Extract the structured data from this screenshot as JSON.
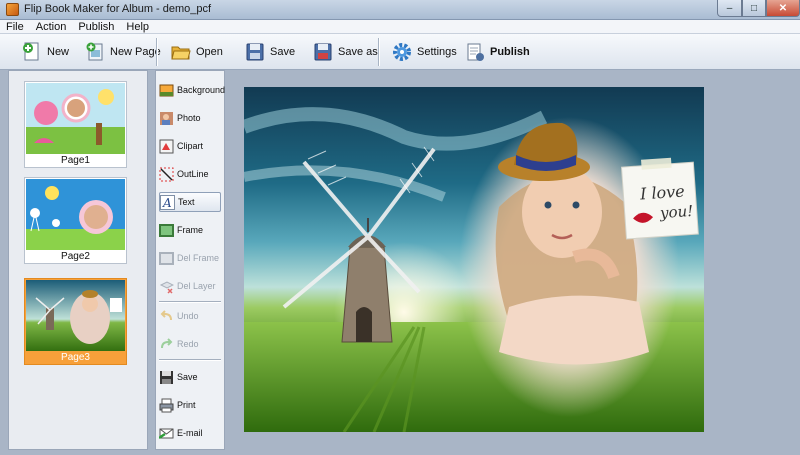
{
  "window": {
    "title": "Flip Book Maker for Album - demo_pcf"
  },
  "menu": [
    "File",
    "Action",
    "Publish",
    "Help"
  ],
  "toolbar": {
    "new": "New",
    "new_page": "New Page",
    "open": "Open",
    "save": "Save",
    "save_as": "Save as",
    "settings": "Settings",
    "publish": "Publish"
  },
  "pages": [
    {
      "label": "Page1",
      "selected": false
    },
    {
      "label": "Page2",
      "selected": false
    },
    {
      "label": "Page3",
      "selected": true
    }
  ],
  "tools": {
    "background": "Background",
    "photo": "Photo",
    "clipart": "Clipart",
    "outline": "OutLine",
    "text": "Text",
    "frame": "Frame",
    "del_frame": "Del Frame",
    "del_layer": "Del Layer",
    "undo": "Undo",
    "redo": "Redo",
    "save": "Save",
    "print": "Print",
    "email": "E-mail"
  },
  "note": {
    "line1": "I love",
    "line2": "you!"
  },
  "colors": {
    "selected_page": "#f7a03a",
    "accent": "#1f6b86"
  }
}
